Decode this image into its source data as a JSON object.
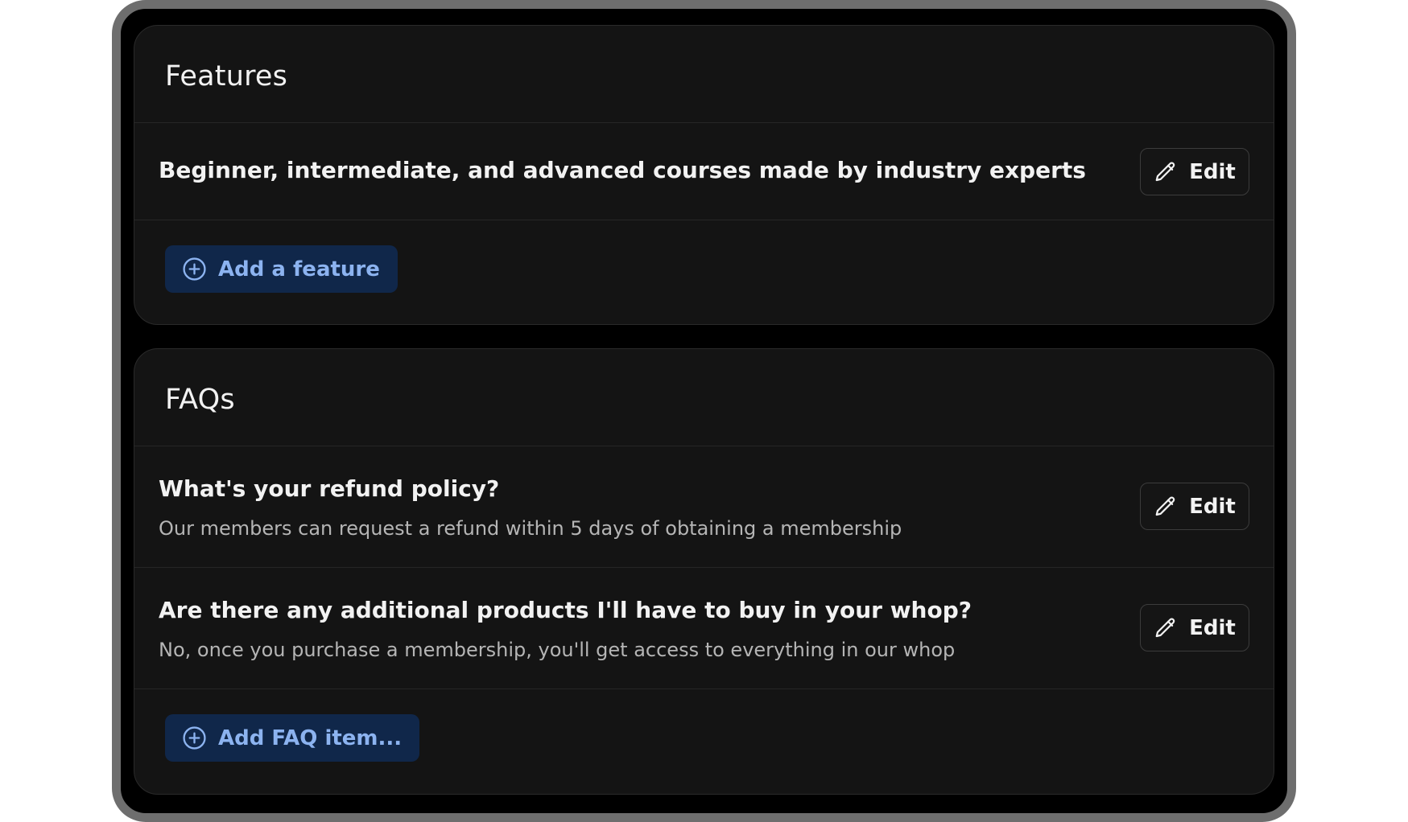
{
  "features": {
    "title": "Features",
    "items": [
      {
        "text": "Beginner, intermediate, and advanced courses made by industry experts",
        "edit_label": "Edit"
      }
    ],
    "add_label": "Add a feature"
  },
  "faqs": {
    "title": "FAQs",
    "items": [
      {
        "question": "What's your refund policy?",
        "answer": "Our members can request a refund within 5 days of obtaining a membership",
        "edit_label": "Edit"
      },
      {
        "question": "Are there any additional products I'll have to buy in your whop?",
        "answer": "No, once you purchase a membership, you'll get access to everything in our whop",
        "edit_label": "Edit"
      }
    ],
    "add_label": "Add FAQ item..."
  },
  "icons": {
    "edit": "pencil-icon",
    "add": "plus-circle-icon"
  },
  "colors": {
    "background": "#000000",
    "card": "#141414",
    "accent_button_bg": "#10274a",
    "accent_text": "#8cb3f0"
  }
}
